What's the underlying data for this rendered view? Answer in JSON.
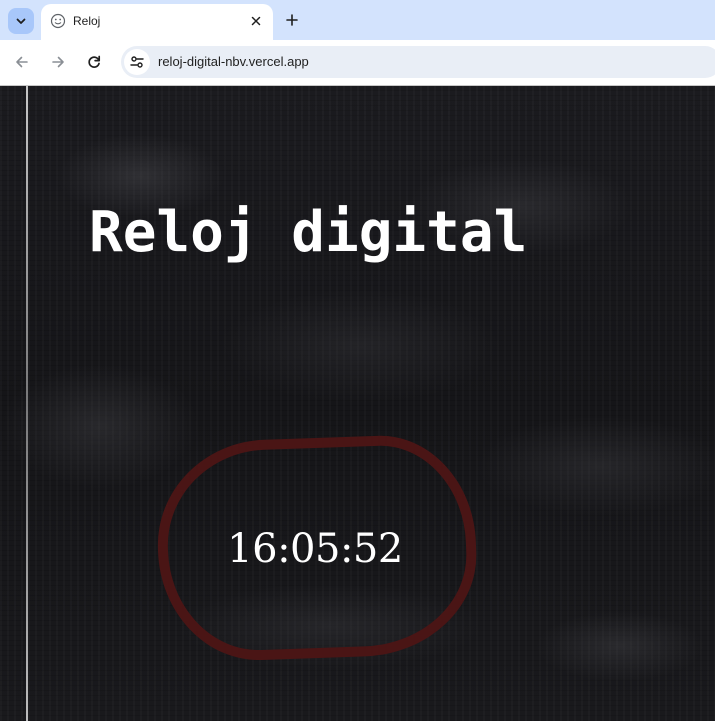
{
  "browser": {
    "tab": {
      "title": "Reloj",
      "favicon": "smiley-face-icon",
      "close_icon": "close-icon"
    },
    "tab_list_icon": "chevron-down-icon",
    "new_tab_icon": "plus-icon",
    "toolbar": {
      "back_icon": "arrow-left-icon",
      "forward_icon": "arrow-right-icon",
      "reload_icon": "reload-icon",
      "site_info_icon": "tune-icon",
      "url": "reloj-digital-nbv.vercel.app"
    }
  },
  "page": {
    "heading": "Reloj digital",
    "time": "16:05:52"
  },
  "colors": {
    "tabstrip": "#d3e3fd",
    "page_background": "#141417",
    "ring": "#4a1515",
    "text": "#ffffff"
  }
}
